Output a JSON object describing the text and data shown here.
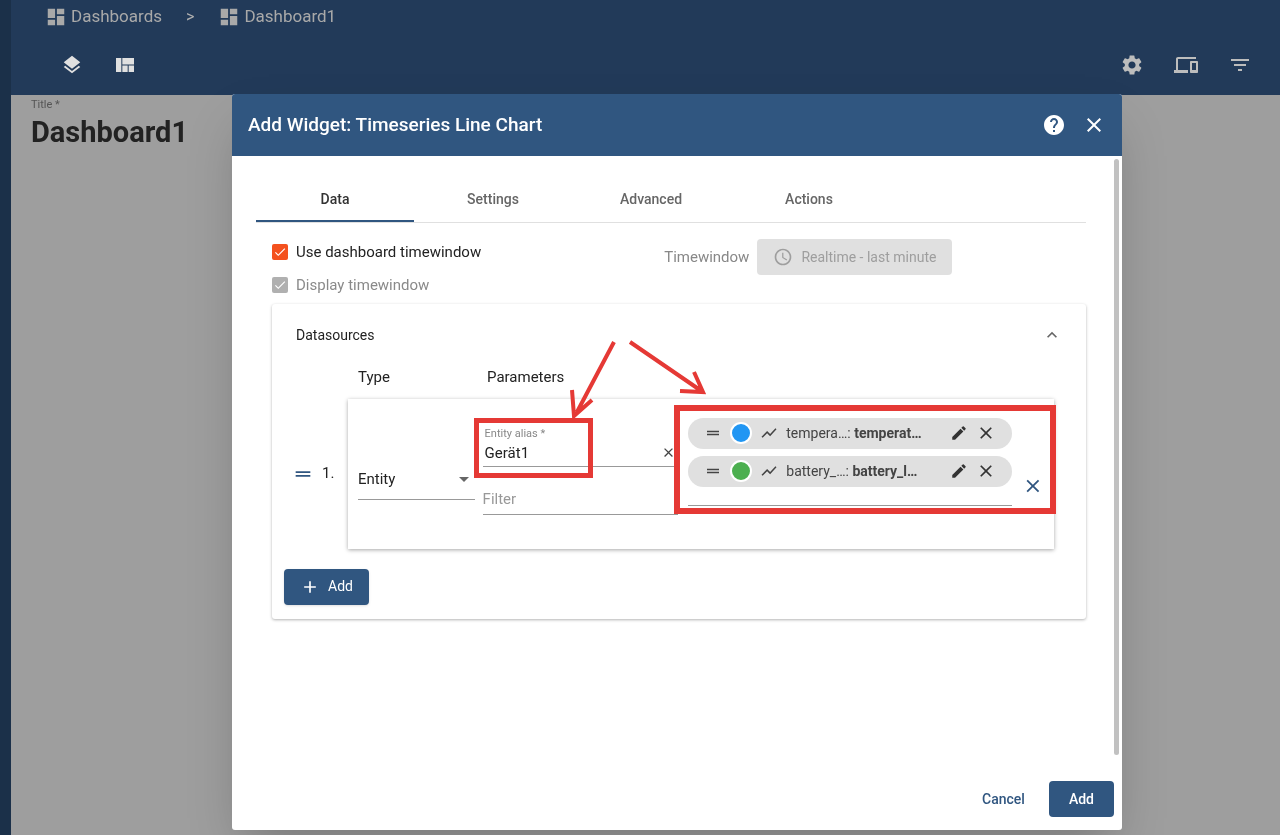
{
  "breadcrumb": [
    {
      "label": "Dashboards"
    },
    {
      "label": ">"
    },
    {
      "label": "Dashboard1"
    }
  ],
  "dashboard": {
    "title_label": "Title *",
    "title": "Dashboard1"
  },
  "dialog": {
    "title": "Add Widget: Timeseries Line Chart",
    "tabs": [
      {
        "label": "Data",
        "selected": true
      },
      {
        "label": "Settings",
        "selected": false
      },
      {
        "label": "Advanced",
        "selected": false
      },
      {
        "label": "Actions",
        "selected": false
      }
    ],
    "options": [
      {
        "label": "Use dashboard timewindow",
        "checked": true,
        "disabled": false
      },
      {
        "label": "Display timewindow",
        "checked": true,
        "disabled": true
      }
    ],
    "timewindow": {
      "label": "Timewindow",
      "value": "Realtime - last minute"
    },
    "datasources": {
      "title": "Datasources",
      "expanded": true,
      "columns": [
        "Type",
        "Parameters"
      ],
      "rows": [
        {
          "index": "1.",
          "type": "Entity",
          "alias_label": "Entity alias *",
          "alias": "Gerät1",
          "filter_placeholder": "Filter",
          "keys": [
            {
              "text": "tempera…: **temperat…**",
              "color": "#2196f3"
            },
            {
              "text": "battery_…: **battery_l…**",
              "color": "#4caf50"
            }
          ]
        }
      ],
      "add_button": "Add"
    },
    "cancel": "Cancel",
    "add": "Add"
  }
}
